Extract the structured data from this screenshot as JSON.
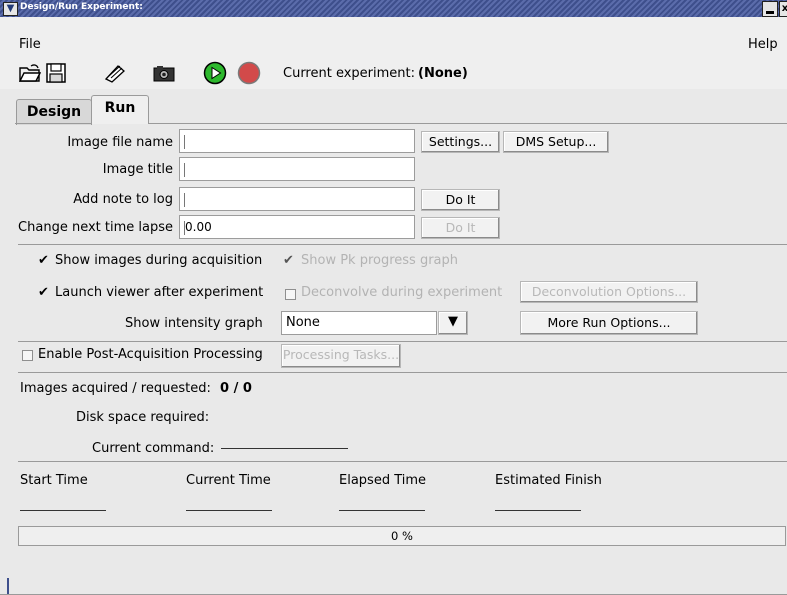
{
  "window": {
    "title": "Design/Run Experiment:",
    "minimize_label": "–",
    "close_label": "x"
  },
  "menubar": {
    "file": "File",
    "help": "Help"
  },
  "toolbar": {
    "icons": [
      "open-folder-icon",
      "save-icon",
      "edit-icon",
      "camera-icon",
      "play-icon",
      "stop-icon"
    ],
    "current_experiment_label": "Current experiment:",
    "current_experiment_value": "(None)"
  },
  "tabs": [
    {
      "label": "Design",
      "active": false
    },
    {
      "label": "Run",
      "active": true
    }
  ],
  "run": {
    "image_file_name_label": "Image file name",
    "image_file_name_value": "",
    "settings_button": "Settings...",
    "dms_setup_button": "DMS Setup...",
    "image_title_label": "Image title",
    "image_title_value": "",
    "add_note_label": "Add note to log",
    "add_note_value": "",
    "do_it_button": "Do It",
    "change_lapse_label": "Change next time lapse",
    "change_lapse_value": "0.00",
    "do_it_disabled_button": "Do It",
    "show_images_label": "Show images during acquisition",
    "show_images_checked": true,
    "show_pk_label": "Show Pk progress graph",
    "show_pk_checked": true,
    "launch_viewer_label": "Launch viewer after experiment",
    "launch_viewer_checked": true,
    "deconvolve_label": "Deconvolve during experiment",
    "deconvolve_checked": false,
    "deconvolution_options_button": "Deconvolution Options...",
    "intensity_graph_label": "Show intensity graph",
    "intensity_graph_value": "None",
    "more_run_options_button": "More Run Options...",
    "post_acq_label": "Enable Post-Acquisition Processing",
    "post_acq_checked": false,
    "processing_tasks_button": "Processing Tasks...",
    "images_acquired_label": "Images acquired / requested:",
    "images_acquired_value": "0 / 0",
    "disk_space_label": "Disk space required:",
    "current_command_label": "Current command:",
    "time_headers": [
      "Start Time",
      "Current Time",
      "Elapsed Time",
      "Estimated Finish"
    ],
    "progress_text": "0 %",
    "progress_value": 0
  },
  "colors": {
    "title_bar": "#3e4f8c",
    "window_bg": "#e9e9e9",
    "play_green": "#2db82d",
    "stop_red": "#d24a4a"
  }
}
